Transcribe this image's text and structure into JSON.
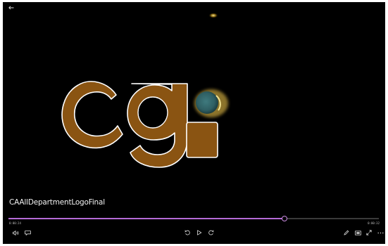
{
  "window": {
    "back_icon": "back-arrow-icon"
  },
  "video": {
    "title": "CAAllDepartmentLogoFinal",
    "logo_text": "CGi",
    "logo_color": "#8a5412",
    "logo_outline_color": "#ffffff",
    "glow_color": "#ffe27a",
    "orb_color": "#2f5f63"
  },
  "timeline": {
    "progress_fraction": 0.745,
    "accent_color": "#b46ad6",
    "elapsed": "0:00:24",
    "total": "0:00:32"
  },
  "controls": {
    "left": [
      "volume-icon",
      "subtitles-icon"
    ],
    "center": [
      "rewind-10-icon",
      "play-icon",
      "forward-30-icon"
    ],
    "right": [
      "edit-pencil-icon",
      "aspect-ratio-icon",
      "fullscreen-icon",
      "more-options-icon"
    ]
  }
}
